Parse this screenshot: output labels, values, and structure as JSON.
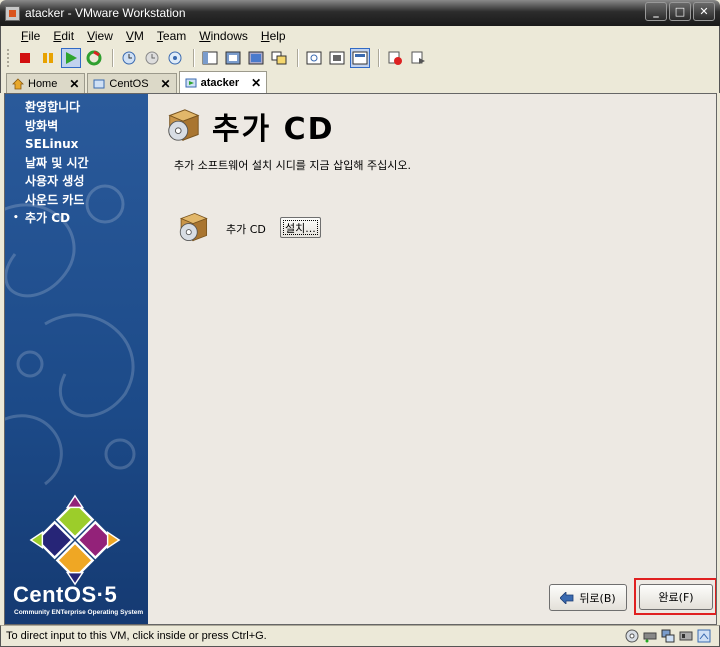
{
  "window": {
    "title": "atacker - VMware Workstation",
    "controls": [
      "_",
      "□",
      "✕"
    ]
  },
  "menu": [
    {
      "key": "F",
      "rest": "ile"
    },
    {
      "key": "E",
      "rest": "dit"
    },
    {
      "key": "V",
      "rest": "iew"
    },
    {
      "key": "V",
      "rest": "M"
    },
    {
      "key": "T",
      "rest": "eam"
    },
    {
      "key": "W",
      "rest": "indows"
    },
    {
      "key": "H",
      "rest": "elp"
    }
  ],
  "toolbar": {
    "icons": [
      "stop-icon",
      "pause-icon",
      "play-icon",
      "reset-icon",
      "snapshot-icon",
      "revert-snapshot-icon",
      "snapshot-manager-icon",
      "sidebar-toggle-icon",
      "full-screen-icon",
      "quick-switch-icon",
      "summary-icon",
      "console-icon",
      "unity-icon",
      "view-icon",
      "record-icon",
      "replay-icon"
    ]
  },
  "tabs": [
    {
      "label": "Home",
      "active": false
    },
    {
      "label": "CentOS",
      "active": false
    },
    {
      "label": "atacker",
      "active": true
    }
  ],
  "sidebar": {
    "items": [
      "환영합니다",
      "방화벽",
      "SELinux",
      "날짜 및 시간",
      "사용자 생성",
      "사운드 카드",
      "추가 CD"
    ],
    "current_index": 6,
    "bullet": "•",
    "brand": "CentOS·5",
    "brand_tagline": "Community ENTerprise Operating System"
  },
  "main": {
    "title": "추가 CD",
    "description": "추가 소프트웨어 설치 시디를 지금 삽입해 주십시오.",
    "item_label": "추가 CD",
    "install_button": "설치...",
    "back_button": "뒤로(B)",
    "finish_button": "완료(F)"
  },
  "status": {
    "text": "To direct input to this VM, click inside or press Ctrl+G."
  },
  "colors": {
    "sidebar_bg": "#1f4d8c",
    "highlight": "#e02020",
    "titlebar": "#2c2c2c"
  }
}
